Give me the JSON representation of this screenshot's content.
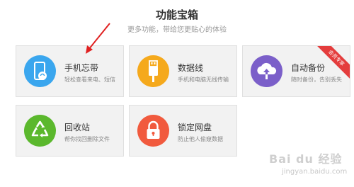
{
  "header": {
    "title": "功能宝箱",
    "subtitle": "更多功能，带给您更贴心的体验"
  },
  "cards": [
    {
      "title": "手机忘带",
      "desc": "轻松查看来电、短信",
      "icon": "phone-cloud-icon",
      "color": "#3aa6ee"
    },
    {
      "title": "数据线",
      "desc": "手机和电脑无线传输",
      "icon": "usb-cable-icon",
      "color": "#f5a91c"
    },
    {
      "title": "自动备份",
      "desc": "随时备份，告别丢失",
      "icon": "cloud-upload-icon",
      "color": "#7b5fc9",
      "badge": "会员专享"
    },
    {
      "title": "回收站",
      "desc": "帮你找回删除文件",
      "icon": "recycle-icon",
      "color": "#5bb82d"
    },
    {
      "title": "锁定网盘",
      "desc": "防止他人偷窥数据",
      "icon": "lock-icon",
      "color": "#f15a3e"
    }
  ],
  "watermark": {
    "brand": "Bai du 经验",
    "url": "jingyan.baidu.com"
  }
}
